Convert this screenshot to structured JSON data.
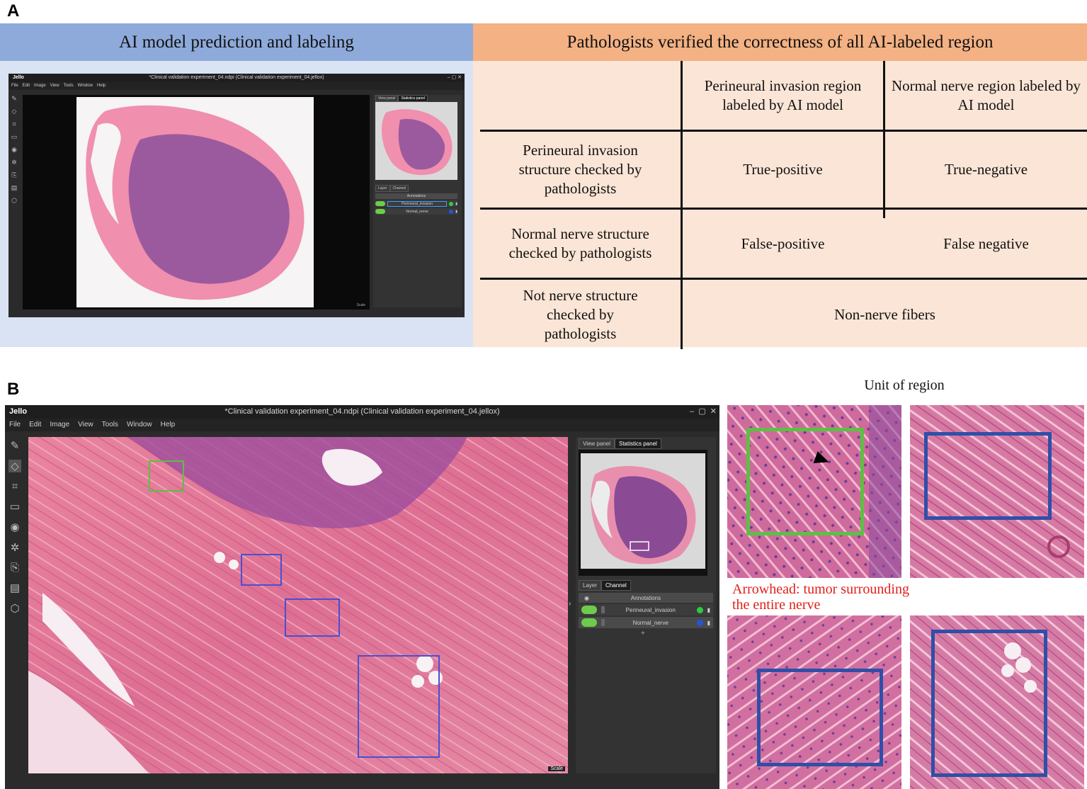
{
  "panel_a": {
    "letter": "A",
    "left_header": "AI model prediction and labeling",
    "right_header": "Pathologists verified the correctness of all AI-labeled region",
    "table": {
      "col_headers": [
        "Perineural invasion region labeled by AI model",
        "Normal nerve region labeled by AI model"
      ],
      "row_headers": [
        "Perineural invasion structure checked by pathologists",
        "Normal nerve structure checked by pathologists",
        "Not nerve structure checked by pathologists"
      ],
      "cells": [
        [
          "True-positive",
          "True-negative"
        ],
        [
          "False-positive",
          "False negative"
        ],
        [
          "Non-nerve fibers"
        ]
      ]
    }
  },
  "app_small": {
    "logo": "Jello",
    "title": "*Clinical validation experiment_04.ndpi (Clinical validation experiment_04.jellox)",
    "menu": [
      "File",
      "Edit",
      "Image",
      "View",
      "Tools",
      "Window",
      "Help"
    ],
    "tabs": [
      "View panel",
      "Statistics panel"
    ],
    "layer_tabs": [
      "Layer",
      "Channel"
    ],
    "annotations_label": "Annotations",
    "layers": [
      {
        "name": "Perineural_invasion",
        "color": "#2ecc40"
      },
      {
        "name": "Normal_nerve",
        "color": "#2255dd"
      }
    ],
    "scale_text": "Scale"
  },
  "app_large": {
    "logo": "Jello",
    "title": "*Clinical validation experiment_04.ndpi (Clinical validation experiment_04.jellox)",
    "menu": [
      "File",
      "Edit",
      "Image",
      "View",
      "Tools",
      "Window",
      "Help"
    ],
    "tabs": [
      "View panel",
      "Statistics panel"
    ],
    "layer_tabs": [
      "Layer",
      "Channel"
    ],
    "annotations_label": "Annotations",
    "layers": [
      {
        "name": "Perineural_invasion",
        "color": "#2ecc40"
      },
      {
        "name": "Normal_nerve",
        "color": "#2255dd"
      }
    ],
    "add_symbol": "+",
    "scale_text": "Scale"
  },
  "panel_b": {
    "letter": "B",
    "unit_title": "Unit of region",
    "caption_line1": "Arrowhead: tumor surrounding",
    "caption_line2": "the entire nerve",
    "caption_color": "#e0201b",
    "box_colors": {
      "perineural": "#5cc043",
      "normal": "#2f4fa8"
    }
  },
  "icons": [
    "pencil-icon",
    "eraser-icon",
    "crop-icon",
    "rectangle-icon",
    "eye-icon",
    "settings-icon",
    "export-icon",
    "clipboard-icon",
    "cube-icon",
    "minimize-icon",
    "restore-icon",
    "close-icon",
    "eye-icon",
    "trash-icon",
    "chevron-right-icon"
  ]
}
